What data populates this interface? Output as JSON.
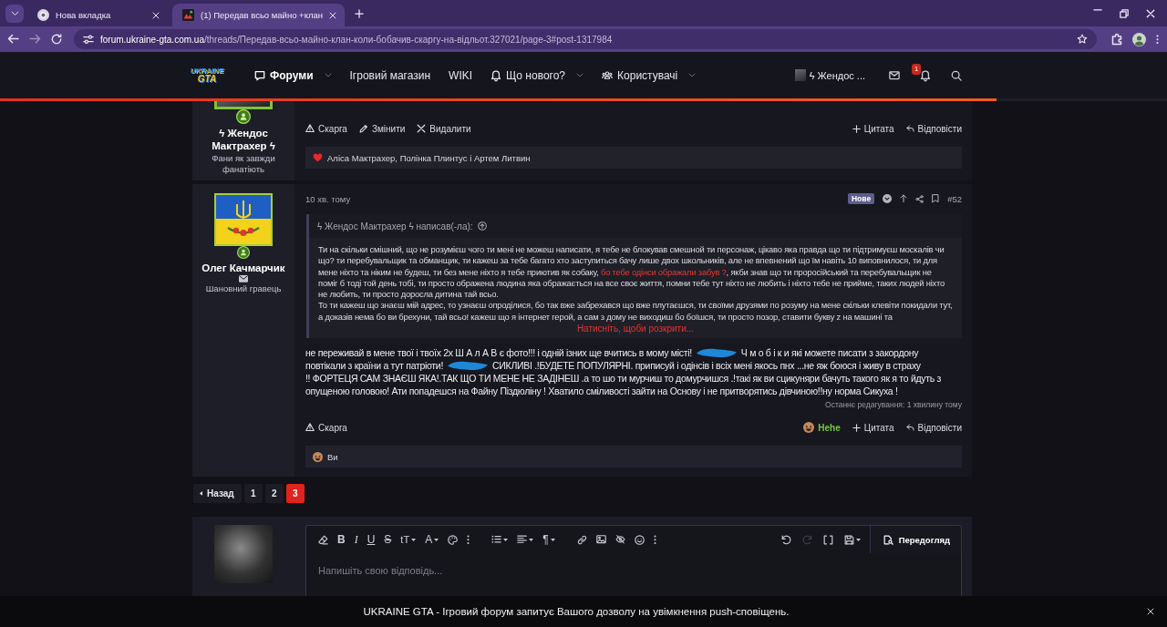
{
  "browser": {
    "tabs": [
      {
        "kind": "newtab",
        "title": "Нова вкладка",
        "selected": false
      },
      {
        "kind": "site",
        "title": "(1) Передав всьо майно +клан",
        "selected": true
      }
    ],
    "address": {
      "domain": "forum.ukraine-gta.com.ua",
      "path": "/threads/Передав-всьо-майно-клан-коли-бобачив-скаргу-на-відльот.327021/page-3#post-1317984"
    }
  },
  "site_header": {
    "logo": {
      "line1": "UKRAINE",
      "line2": "GTA"
    },
    "nav": [
      {
        "kind": "forums",
        "label": "Форуми",
        "selected": true,
        "dropdown": true
      },
      {
        "kind": "plain",
        "label": "Ігровий магазин",
        "selected": false,
        "dropdown": false
      },
      {
        "kind": "plain",
        "label": "WIKI",
        "selected": false,
        "dropdown": false
      },
      {
        "kind": "news",
        "label": "Що нового?",
        "selected": false,
        "dropdown": true
      },
      {
        "kind": "members",
        "label": "Користувачі",
        "selected": false,
        "dropdown": true
      }
    ],
    "user": {
      "name": "ϟ Жендос ..."
    },
    "alerts_badge": "1"
  },
  "reading_progress": {
    "level": 0.854
  },
  "posts": [
    {
      "author": "ϟ Жендос Мактрахер ϟ",
      "user_title": "Фани як завжди фанатіють",
      "avatar": {
        "kind": "photo",
        "cropped": true
      },
      "message_icon": false,
      "actions_left": [
        {
          "kind": "report",
          "label": "Скарга"
        },
        {
          "kind": "edit",
          "label": "Змінити"
        },
        {
          "kind": "delete",
          "label": "Видалити"
        }
      ],
      "actions_right": [
        {
          "kind": "quote",
          "label": "Цитата"
        },
        {
          "kind": "reply",
          "label": "Відповісти"
        }
      ],
      "reactions": {
        "kind": "like",
        "text": "Аліса Мактрахер, Полінка Плинтус і Артем Литвин"
      }
    },
    {
      "author": "Олег Качмарчик",
      "user_title": "Шановний гравець",
      "avatar": {
        "kind": "flag",
        "cropped": false
      },
      "message_icon": true,
      "time": "10 хв. тому",
      "new_label": "Нове",
      "number": "#52",
      "quote": {
        "author_line": "ϟ Жендос Мактрахер ϟ написав(-ла):",
        "paragraphs": [
          [
            {
              "kind": "plain",
              "text": "Ти на скільки смішний, що не розумієш чого ти мені не можеш написати, я тебе не блокував смешной ти персонаж, цікаво яка правда що ти підтримуєш москалів чи що? ти перебувальщик та обманщик, ти кажеш за тебе багато хто заступиться бачу лише двох школьників, але не впевнений що їм навіть 10 виповнилося, ти для мене ніхто та ніким не будеш, ти без мене ніхто я тебе приютив як собаку, "
            },
            {
              "kind": "highlight",
              "text": "бо тебе одінси ображали забув ?"
            },
            {
              "kind": "plain",
              "text": ", якби знав що ти проросійський та перебувальщик не поміг б тоді той день тобі, ти просто ображена людина яка ображається на все своє життя, помни тебе тут ніхто не любить і ніхто тебе не прийме, таких людей ніхто не любить, ти просто доросла дитина тай всьо."
            }
          ],
          [
            {
              "kind": "plain",
              "text": "То ти кажеш що знаєш мій адрес, то узнаєш опроділися, бо так вже забрехався що вже плутаєшся, ти своїми друзями по розуму на мене скільки клевіти покидали тут, а доказів нема бо ви брехуни, тай всьо! кажеш що я інтернет герой, а сам з дому не виходиш бо боїшся, ти просто позор, ставити букву z на машині та"
            }
          ]
        ],
        "expand": "Натисніть, щоби розкрити..."
      },
      "body_lines": [
        [
          {
            "kind": "text",
            "text": "не переживай в мене твої і твоїх 2х Ш А л А В є фото!!! і одній ізних ще вчитись в мому місті!"
          },
          {
            "kind": "redaction"
          },
          {
            "kind": "text",
            "text": "Ч м о б і к и які можете писати з закордону"
          }
        ],
        [
          {
            "kind": "text",
            "text": "повтікали з країни а тут патріоти!"
          },
          {
            "kind": "redaction"
          },
          {
            "kind": "text",
            "text": "СИКЛИВІ .!БУДЕТЕ ПОПУЛЯРНІ. приписуй і одінсів і всіх мені якось пнх ...не яж боюся і живу в страху"
          }
        ],
        [
          {
            "kind": "text",
            "text": "!! ФОРТЕЦЯ САМ ЗНАЄШ ЯКА!.ТАК ЩО ТИ МЕНЕ НЕ ЗАДІНЕШ .а то шо ти мурчиш то домурчишся .!такі як ви сцикуняри бачуть такого як я то йдуть з"
          }
        ],
        [
          {
            "kind": "text",
            "text": "опущеною головою! Ати попадешся на Файну Піздюліну ! Хватило сміливості зайти на Основу і не притворятись дівчиною!!ну норма Сикуха !"
          }
        ]
      ],
      "last_edit": "Останнє редагування: 1 хвилину тому",
      "actions_left": [
        {
          "kind": "report",
          "label": "Скарга"
        }
      ],
      "actions_right": [
        {
          "kind": "reaction",
          "label": "Hehe"
        },
        {
          "kind": "quote",
          "label": "Цитата"
        },
        {
          "kind": "reply",
          "label": "Відповісти"
        }
      ],
      "reactions": {
        "kind": "hehe",
        "text": "Ви"
      }
    }
  ],
  "pagination": {
    "prev": "Назад",
    "pages": [
      {
        "label": "1",
        "selected": false
      },
      {
        "label": "2",
        "selected": false
      },
      {
        "label": "3",
        "selected": true
      }
    ]
  },
  "editor": {
    "avatar": {
      "kind": "photo"
    },
    "toolbar_left": [
      [
        {
          "kind": "eraser",
          "dropdown": false
        },
        {
          "kind": "bold",
          "label": "B",
          "dropdown": false
        },
        {
          "kind": "italic",
          "label": "I",
          "dropdown": false
        },
        {
          "kind": "underline",
          "label": "U",
          "dropdown": false
        },
        {
          "kind": "strike",
          "label": "S",
          "dropdown": false
        },
        {
          "kind": "size",
          "label": "tT",
          "dropdown": true
        },
        {
          "kind": "color",
          "label": "A",
          "dropdown": true
        },
        {
          "kind": "palette",
          "dropdown": false
        },
        {
          "kind": "more",
          "dropdown": false
        }
      ],
      [
        {
          "kind": "list",
          "dropdown": true
        },
        {
          "kind": "align",
          "dropdown": true
        },
        {
          "kind": "paragraph",
          "label": "¶",
          "dropdown": true
        }
      ],
      [
        {
          "kind": "link",
          "dropdown": false
        },
        {
          "kind": "image",
          "dropdown": false
        },
        {
          "kind": "hide",
          "dropdown": false
        },
        {
          "kind": "emoji",
          "dropdown": false
        },
        {
          "kind": "more",
          "dropdown": false
        }
      ]
    ],
    "toolbar_right": [
      {
        "kind": "undo",
        "dropdown": false,
        "disabled": false
      },
      {
        "kind": "redo",
        "dropdown": false,
        "disabled": true
      },
      {
        "kind": "code",
        "dropdown": false,
        "disabled": false
      },
      {
        "kind": "save",
        "dropdown": true,
        "disabled": false
      }
    ],
    "preview": "Передогляд",
    "placeholder": "Напишіть свою відповідь..."
  },
  "notice": {
    "text": "UKRAINE GTA - Ігровий форум запитує Вашого дозволу на увімкнення push-сповіщень."
  }
}
